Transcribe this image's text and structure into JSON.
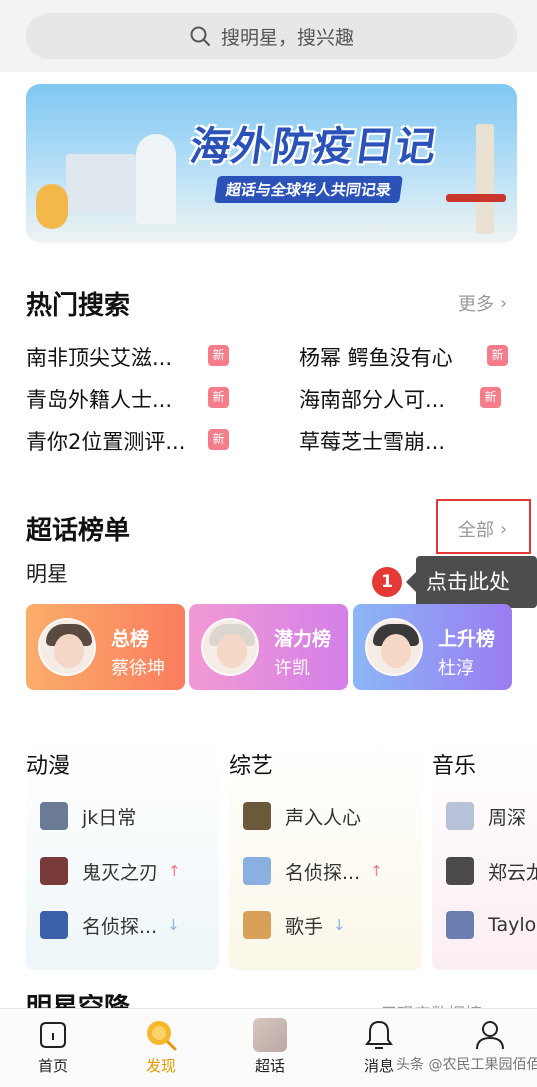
{
  "search": {
    "placeholder": "搜明星，搜兴趣"
  },
  "banner": {
    "title": "海外防疫日记",
    "subtitle": "超话与全球华人共同记录"
  },
  "hot_search": {
    "title": "热门搜索",
    "more": "更多",
    "items": [
      {
        "text": "南非顶尖艾滋...",
        "badge": "新"
      },
      {
        "text": "杨幂 鳄鱼没有心",
        "badge": "新"
      },
      {
        "text": "青岛外籍人士...",
        "badge": "新"
      },
      {
        "text": "海南部分人可...",
        "badge": "新"
      },
      {
        "text": "青你2位置测评...",
        "badge": "新"
      },
      {
        "text": "草莓芝士雪崩...",
        "badge": ""
      }
    ]
  },
  "ranking": {
    "title": "超话榜单",
    "all": "全部",
    "subtitle": "明星",
    "annotation": {
      "number": "1",
      "text": "点击此处"
    },
    "cards": [
      {
        "name": "总榜",
        "star": "蔡徐坤",
        "color": "#fb7d5f"
      },
      {
        "name": "潜力榜",
        "star": "许凯",
        "color": "#e07fe0"
      },
      {
        "name": "上升榜",
        "star": "杜淳",
        "color": "#8e86f7"
      }
    ]
  },
  "categories": [
    {
      "title": "动漫",
      "items": [
        {
          "label": "jk日常",
          "trend": ""
        },
        {
          "label": "鬼灭之刃",
          "trend": "↑"
        },
        {
          "label": "名侦探...",
          "trend": "↓"
        }
      ]
    },
    {
      "title": "综艺",
      "items": [
        {
          "label": "声入人心",
          "trend": ""
        },
        {
          "label": "名侦探...",
          "trend": "↑"
        },
        {
          "label": "歌手",
          "trend": "↓"
        }
      ]
    },
    {
      "title": "音乐",
      "items": [
        {
          "label": "周深",
          "trend": ""
        },
        {
          "label": "郑云龙",
          "trend": ""
        },
        {
          "label": "Taylor",
          "trend": ""
        }
      ]
    }
  ],
  "next_section": {
    "title": "明星空降",
    "right": "用现实数据榜..."
  },
  "nav": [
    {
      "label": "首页",
      "active": false
    },
    {
      "label": "发现",
      "active": true
    },
    {
      "label": "超话",
      "active": false
    },
    {
      "label": "消息",
      "active": false
    },
    {
      "label": "",
      "active": false
    }
  ],
  "watermark": "头条 @农民工果园佰佰",
  "colors": {
    "accent": "#e39a00",
    "highlight": "#e53935",
    "badge": "#f57d8a"
  }
}
